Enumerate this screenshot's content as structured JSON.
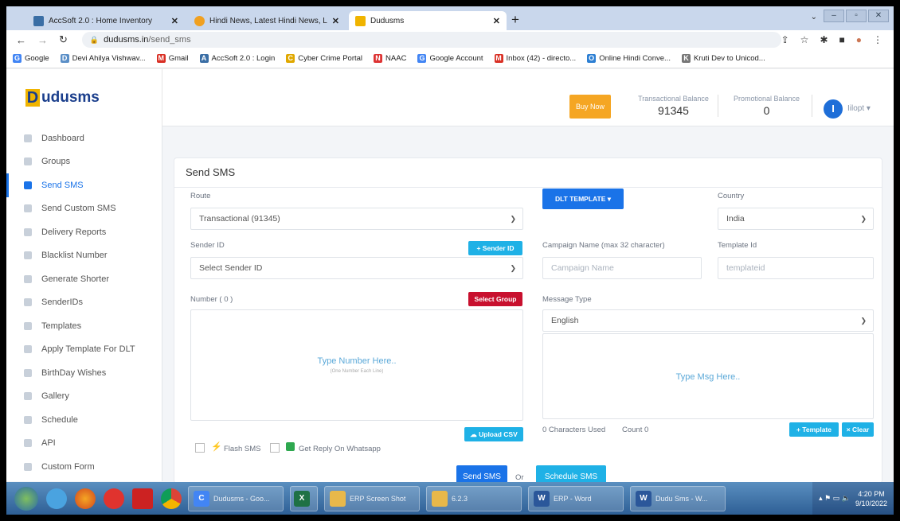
{
  "browser": {
    "tabs": [
      {
        "title": "AccSoft 2.0 : Home Inventory",
        "favicon_color": "#3a6ea5"
      },
      {
        "title": "Hindi News, Latest Hindi News, L",
        "favicon_color": "#f0a020"
      },
      {
        "title": "Dudusms",
        "favicon_color": "#f0b400"
      }
    ],
    "url_host": "dudusms.in",
    "url_path": "/send_sms",
    "bookmarks": [
      {
        "label": "Google",
        "icon": "G",
        "color": "#4285f4"
      },
      {
        "label": "Devi Ahilya Vishwav...",
        "icon": "D",
        "color": "#5b8fc7"
      },
      {
        "label": "Gmail",
        "icon": "M",
        "color": "#d93025"
      },
      {
        "label": "AccSoft 2.0 : Login",
        "icon": "A",
        "color": "#3a6ea5"
      },
      {
        "label": "Cyber Crime Portal",
        "icon": "C",
        "color": "#e0a800"
      },
      {
        "label": "NAAC",
        "icon": "N",
        "color": "#d33"
      },
      {
        "label": "Google Account",
        "icon": "G",
        "color": "#4285f4"
      },
      {
        "label": "Inbox (42) - directo...",
        "icon": "M",
        "color": "#d93025"
      },
      {
        "label": "Online Hindi Conve...",
        "icon": "O",
        "color": "#2d7fd3"
      },
      {
        "label": "Kruti Dev to Unicod...",
        "icon": "K",
        "color": "#777"
      }
    ]
  },
  "header": {
    "brand": "udusms",
    "brand_initial": "D",
    "buy_now": "Buy Now",
    "transactional_label": "Transactional Balance",
    "transactional_value": "91345",
    "promotional_label": "Promotional Balance",
    "promotional_value": "0",
    "avatar": "I",
    "user": "Iilopt ▾"
  },
  "sidebar": {
    "items": [
      {
        "label": "Dashboard",
        "active": false
      },
      {
        "label": "Groups",
        "active": false
      },
      {
        "label": "Send SMS",
        "active": true
      },
      {
        "label": "Send Custom SMS",
        "active": false
      },
      {
        "label": "Delivery Reports",
        "active": false
      },
      {
        "label": "Blacklist Number",
        "active": false
      },
      {
        "label": "Generate Shorter",
        "active": false
      },
      {
        "label": "SenderIDs",
        "active": false
      },
      {
        "label": "Templates",
        "active": false
      },
      {
        "label": "Apply Template For DLT",
        "active": false
      },
      {
        "label": "BirthDay Wishes",
        "active": false
      },
      {
        "label": "Gallery",
        "active": false
      },
      {
        "label": "Schedule",
        "active": false
      },
      {
        "label": "API",
        "active": false
      },
      {
        "label": "Custom Form",
        "active": false
      }
    ]
  },
  "form": {
    "title": "Send SMS",
    "route_label": "Route",
    "route_value": "Transactional (91345)",
    "sender_label": "Sender ID",
    "sender_button": "+ Sender ID",
    "sender_placeholder": "Select Sender ID",
    "number_label": "Number ( 0 )",
    "select_group": "Select Group",
    "number_hint": "Type Number Here..",
    "number_subhint": "(One Number Each Line)",
    "upload_csv": "Upload CSV",
    "flash_sms": "Flash SMS",
    "whatsapp": "Get Reply On Whatsapp",
    "dlt_template": "DLT TEMPLATE ▾",
    "country_label": "Country",
    "country_value": "India",
    "campaign_label": "Campaign Name (max 32 character)",
    "campaign_placeholder": "Campaign Name",
    "template_label": "Template Id",
    "template_placeholder": "templateid",
    "message_type_label": "Message Type",
    "message_type_value": "English",
    "msg_hint": "Type Msg Here..",
    "chars_used": "0 Characters Used",
    "count": "Count 0",
    "add_template": "+ Template",
    "clear": "× Clear",
    "send_sms": "Send SMS",
    "or": "Or",
    "schedule_sms": "Schedule SMS"
  },
  "taskbar": {
    "apps": [
      {
        "label": "Dudusms - Goo...",
        "icon": "C",
        "color": "#4285f4"
      },
      {
        "label": "",
        "icon": "X",
        "color": "#1e7145"
      },
      {
        "label": "ERP Screen Shot",
        "icon": "",
        "color": "#e8b84a"
      },
      {
        "label": "6.2.3",
        "icon": "",
        "color": "#e8b84a"
      },
      {
        "label": "ERP - Word",
        "icon": "W",
        "color": "#2b579a"
      },
      {
        "label": "Dudu Sms - W...",
        "icon": "W",
        "color": "#2b579a"
      }
    ],
    "time": "4:20 PM",
    "date": "9/10/2022"
  }
}
